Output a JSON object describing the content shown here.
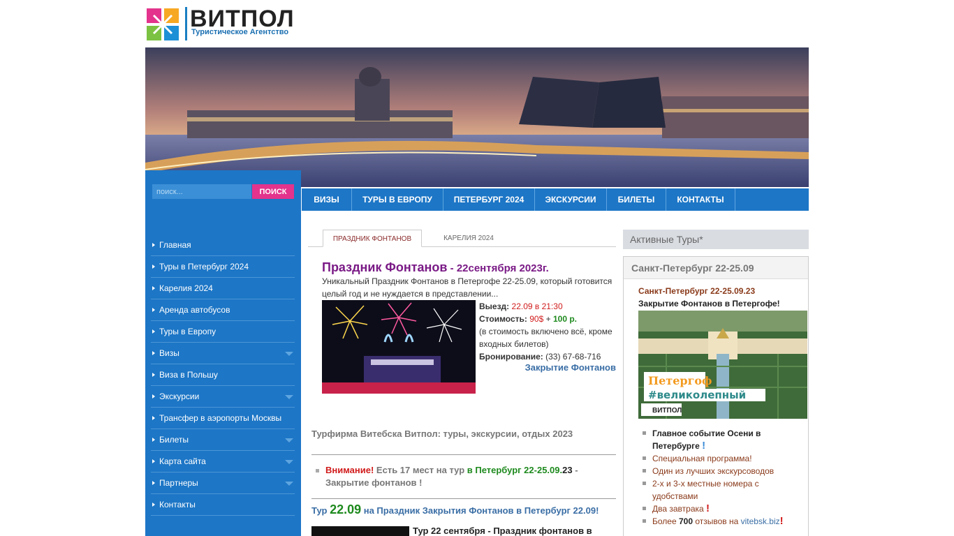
{
  "logo": {
    "name": "ВИТПОЛ",
    "tagline": "Туристическое Агентство"
  },
  "search": {
    "placeholder": "поиск...",
    "button": "ПОИСК"
  },
  "sidebar": {
    "items": [
      {
        "label": "Главная",
        "has_sub": false
      },
      {
        "label": "Туры в Петербург 2024",
        "has_sub": false
      },
      {
        "label": "Карелия 2024",
        "has_sub": false
      },
      {
        "label": "Аренда автобусов",
        "has_sub": false
      },
      {
        "label": "Туры в Европу",
        "has_sub": false
      },
      {
        "label": "Визы",
        "has_sub": true
      },
      {
        "label": "Виза в Польшу",
        "has_sub": false
      },
      {
        "label": "Экскурсии",
        "has_sub": true
      },
      {
        "label": "Трансфер в аэропорты Москвы",
        "has_sub": false
      },
      {
        "label": "Билеты",
        "has_sub": true
      },
      {
        "label": "Карта сайта",
        "has_sub": true
      },
      {
        "label": "Партнеры",
        "has_sub": true
      },
      {
        "label": "Контакты",
        "has_sub": false
      }
    ]
  },
  "topnav": {
    "items": [
      {
        "label": "ВИЗЫ"
      },
      {
        "label": "ТУРЫ В ЕВРОПУ"
      },
      {
        "label": "ПЕТЕРБУРГ 2024"
      },
      {
        "label": "ЭКСКУРСИИ"
      },
      {
        "label": "БИЛЕТЫ"
      },
      {
        "label": "КОНТАКТЫ"
      }
    ]
  },
  "tabs": [
    {
      "label": "ПРАЗДНИК ФОНТАНОВ",
      "active": true
    },
    {
      "label": "КАРЕЛИЯ 2024",
      "active": false
    }
  ],
  "event": {
    "title": "Праздник Фонтанов",
    "date": " - 22сентября 2023г.",
    "desc": "Уникальный Праздник Фонтанов в Петергофе 22-25.09, который готовится целый год и не нуждается в представлении...",
    "depart_label": "Выезд:",
    "depart_value": "22.09 в 21:30",
    "cost_label": "Стоимость:",
    "cost_value1": "90$",
    "cost_plus": " + ",
    "cost_value2": "100 р.",
    "cost_note": "(в стоимость включено всё, кроме входных билетов)",
    "booking_label": "Бронирование:",
    "booking_phone": " (33) 67-68-716",
    "link": "Закрытие Фонтанов"
  },
  "main": {
    "subtitle": "Турфирма Витебска Витпол: туры, экскурсии, отдых 2023",
    "notice_attn": "Внимание!",
    "notice_text1": " Есть 17 мест на тур ",
    "notice_city": "в Петербург 22-25.09.",
    "notice_year": "23",
    "notice_text2": " - Закрытие фонтанов !",
    "tour_prefix": "Тур ",
    "tour_date": "22.09",
    "tour_text": " на Праздник Закрытия Фонтанов в Петербург 22.09!",
    "tour2": "Тур 22 сентября - Праздник фонтанов в"
  },
  "right": {
    "active_head": "Активные Туры*",
    "card_head": "Санкт-Петербург 22-25.09",
    "card_date": "Санкт-Петербург 22-25.09.23",
    "card_sub": "Закрытие Фонтанов в Петергофе!",
    "img_line1": "Петергоф",
    "img_line2": "#великолепный",
    "img_brand": "ВИТПОЛ",
    "list": [
      {
        "text": "Главное событие Осени в Петербурге ",
        "dark": true
      },
      {
        "text": "Специальная программа!",
        "dark": false
      },
      {
        "text": "Один из лучших экскурсоводов",
        "dark": false
      },
      {
        "text": "2-х и 3-х местные номера с удобствами",
        "dark": false
      },
      {
        "text": "Два завтрака ",
        "dark": false
      },
      {
        "text_a": "Более ",
        "text_b": "700",
        "text_c": " отзывов на ",
        "text_d": "vitebsk.biz",
        "dark": false
      }
    ],
    "excl": "!"
  },
  "colors": {
    "primary": "#1d76c6",
    "accent": "#e3338c",
    "title": "#7a1a86",
    "green": "#1e8a1e",
    "red": "#d11b1b"
  }
}
